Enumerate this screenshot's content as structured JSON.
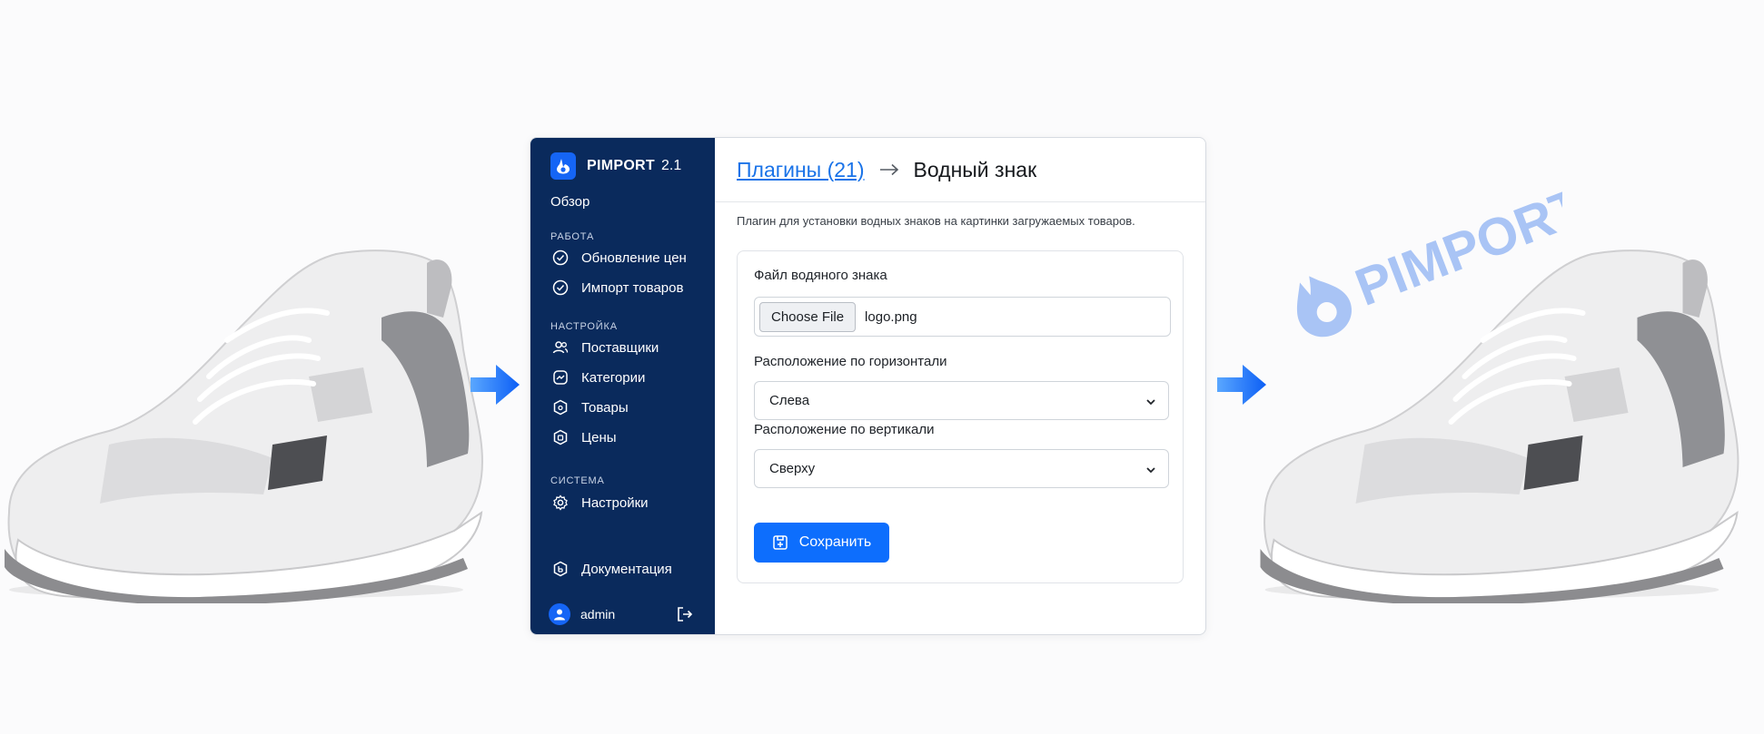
{
  "colors": {
    "sidebar_bg": "#0a2a5c",
    "accent": "#0d6efd",
    "link": "#1a73e8",
    "watermark": "#a9c4f5"
  },
  "watermark": {
    "text": "PIMPORT"
  },
  "brand": {
    "name": "PIMPORT",
    "version": "2.1"
  },
  "sidebar": {
    "overview": "Обзор",
    "sections": [
      {
        "title": "РАБОТА",
        "items": [
          {
            "label": "Обновление цен",
            "icon": "check-circle-icon"
          },
          {
            "label": "Импорт товаров",
            "icon": "check-circle-icon"
          }
        ]
      },
      {
        "title": "НАСТРОЙКА",
        "items": [
          {
            "label": "Поставщики",
            "icon": "users-icon"
          },
          {
            "label": "Категории",
            "icon": "categories-icon"
          },
          {
            "label": "Товары",
            "icon": "box-icon"
          },
          {
            "label": "Цены",
            "icon": "price-icon"
          }
        ]
      },
      {
        "title": "СИСТЕМА",
        "items": [
          {
            "label": "Настройки",
            "icon": "gear-icon"
          }
        ]
      }
    ],
    "documentation": "Документация",
    "user": "admin"
  },
  "header": {
    "breadcrumb_link": "Плагины (21)",
    "breadcrumb_current": "Водный знак"
  },
  "description": "Плагин для установки водных знаков на картинки загружаемых товаров.",
  "form": {
    "file_label": "Файл водяного знака",
    "file_button": "Choose File",
    "file_name": "logo.png",
    "horizontal_label": "Расположение по горизонтали",
    "horizontal_value": "Слева",
    "vertical_label": "Расположение по вертикали",
    "vertical_value": "Сверху",
    "save_label": "Сохранить"
  }
}
